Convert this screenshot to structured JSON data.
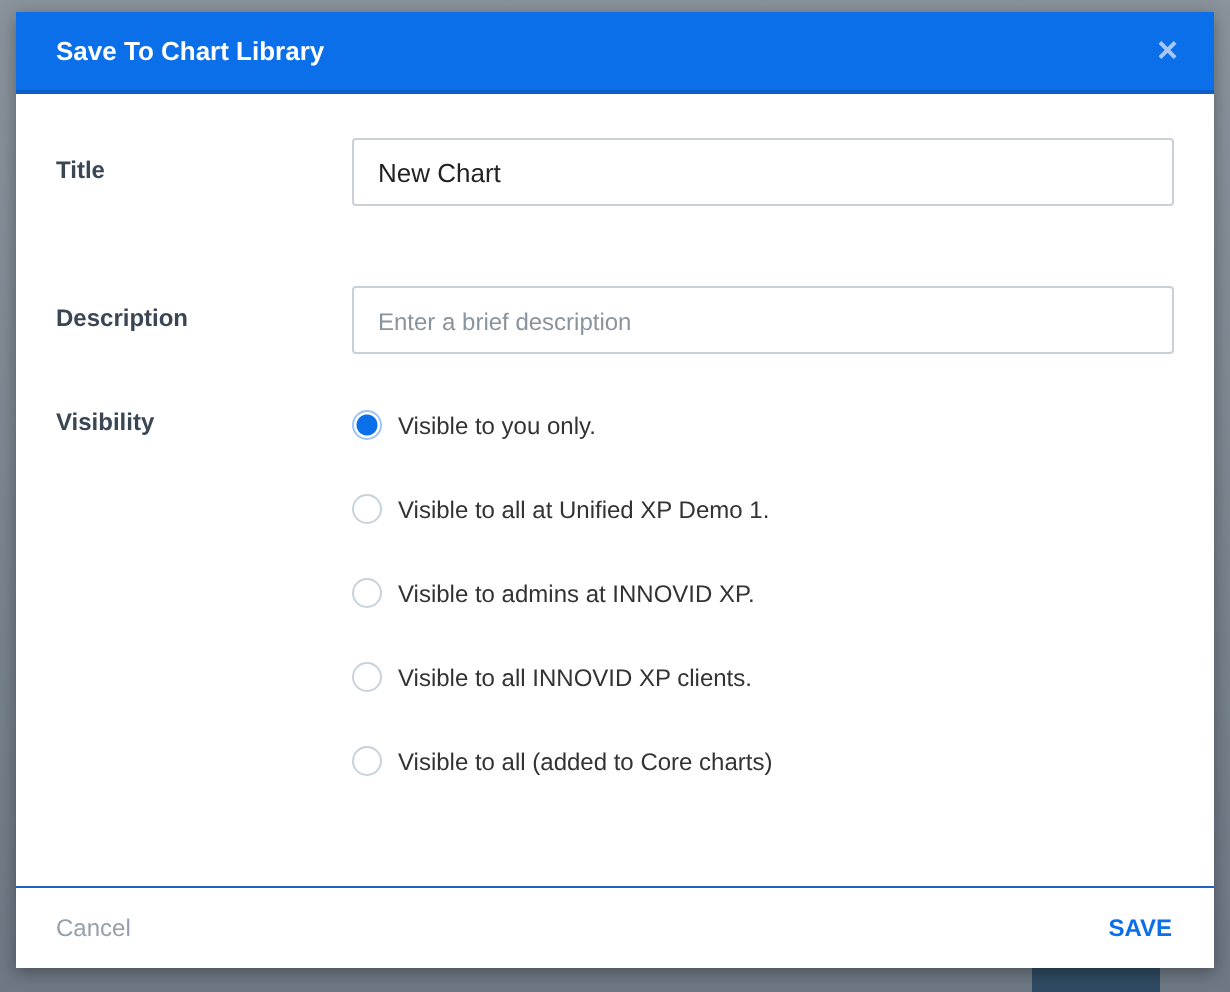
{
  "dialog": {
    "title": "Save To Chart Library",
    "close": "×"
  },
  "fields": [
    {
      "label": "Title",
      "value": "New Chart"
    },
    {
      "label": "Description",
      "placeholder": "Enter a brief description"
    }
  ],
  "visibility": {
    "label": "Visibility",
    "options": [
      {
        "label": "Visible to you only.",
        "selected": true
      },
      {
        "label": "Visible to all at Unified XP Demo 1.",
        "selected": false
      },
      {
        "label": "Visible to admins at INNOVID XP.",
        "selected": false
      },
      {
        "label": "Visible to all INNOVID XP clients.",
        "selected": false
      },
      {
        "label": "Visible to all (added to Core charts)",
        "selected": false
      }
    ]
  },
  "footer": {
    "cancel": "Cancel",
    "save": "SAVE"
  }
}
